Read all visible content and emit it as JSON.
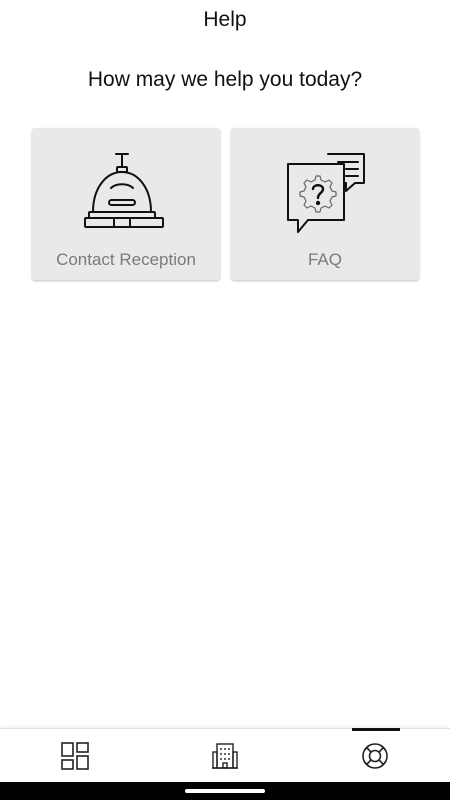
{
  "header": {
    "title": "Help"
  },
  "main": {
    "prompt": "How may we help you today?",
    "options": [
      {
        "label": "Contact Reception",
        "icon": "reception-bell-icon"
      },
      {
        "label": "FAQ",
        "icon": "faq-chat-icon"
      }
    ]
  },
  "bottom_nav": {
    "items": [
      {
        "icon": "dashboard-icon",
        "active": false
      },
      {
        "icon": "building-icon",
        "active": false
      },
      {
        "icon": "lifebuoy-icon",
        "active": true
      }
    ]
  },
  "colors": {
    "card_background": "#e9e9e9",
    "card_label": "#7a7a7a",
    "text": "#111111",
    "active_indicator": "#111111"
  }
}
